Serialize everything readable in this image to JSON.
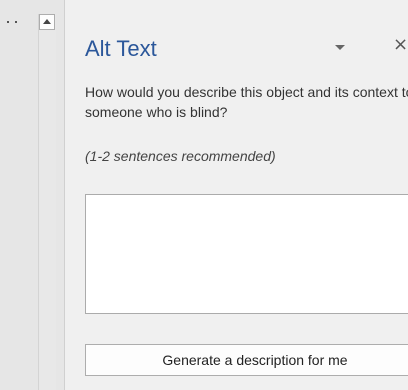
{
  "pane": {
    "title": "Alt Text",
    "question": "How would you describe this object and its context to someone who is blind?",
    "hint": "(1-2 sentences recommended)",
    "description_value": "",
    "generate_button_label": "Generate a description for me"
  },
  "icons": {
    "options": "chevron-down-icon",
    "close": "close-icon",
    "scroll_up": "scroll-up-arrow-icon"
  },
  "colors": {
    "title": "#2b579a",
    "pane_background": "#f0f0f0"
  }
}
